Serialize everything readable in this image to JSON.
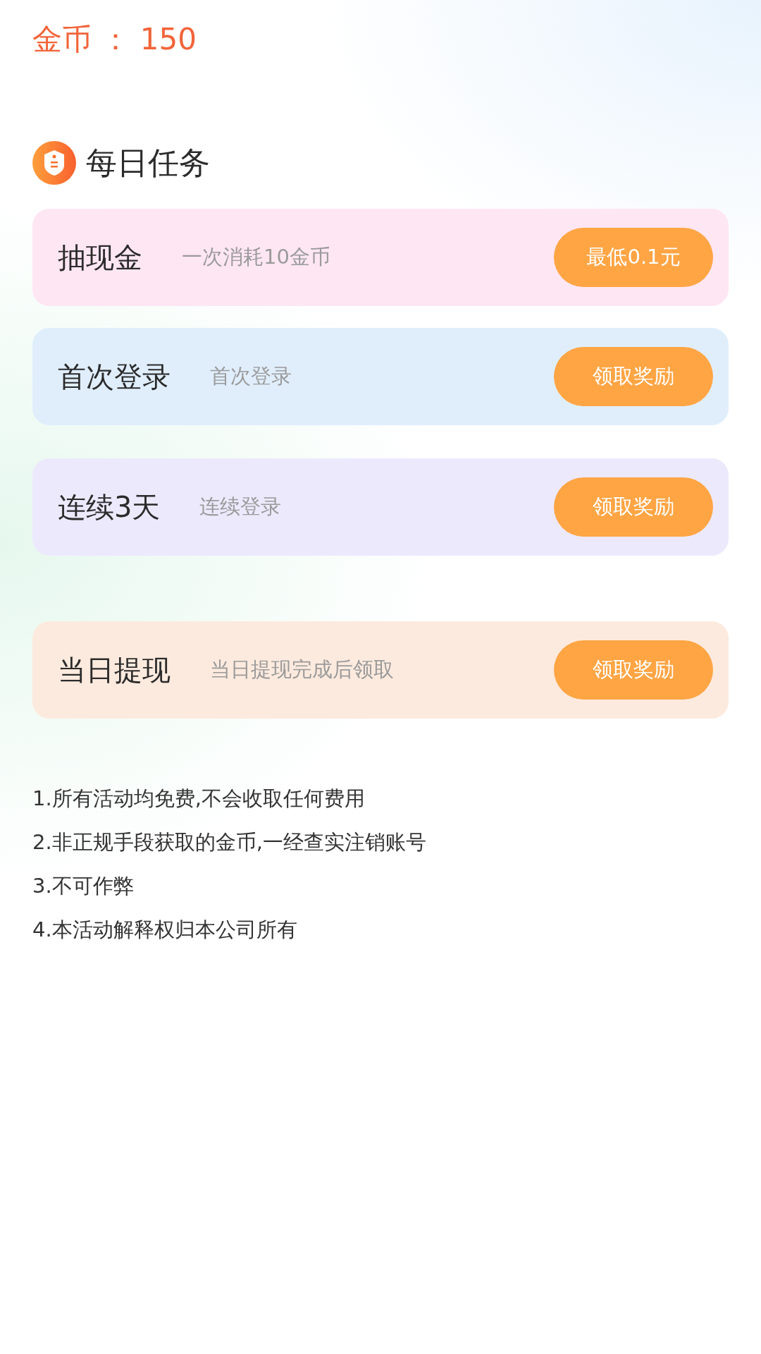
{
  "coins": {
    "label": "金币",
    "separator": "：",
    "value": "150"
  },
  "section": {
    "title": "每日任务"
  },
  "tasks": [
    {
      "title": "抽现金",
      "description": "一次消耗10金币",
      "button": "最低0.1元",
      "color": "#ffe6f3"
    },
    {
      "title": "首次登录",
      "description": "首次登录",
      "button": "领取奖励",
      "color": "#e0eefc"
    },
    {
      "title": "连续3天",
      "description": "连续登录",
      "button": "领取奖励",
      "color": "#ede9fd"
    },
    {
      "title": "当日提现",
      "description": "当日提现完成后领取",
      "button": "领取奖励",
      "color": "#fdeade"
    }
  ],
  "rules": [
    "1.所有活动均免费,不会收取任何费用",
    "2.非正规手段获取的金币,一经查实注销账号",
    "3.不可作弊",
    "4.本活动解释权归本公司所有"
  ]
}
